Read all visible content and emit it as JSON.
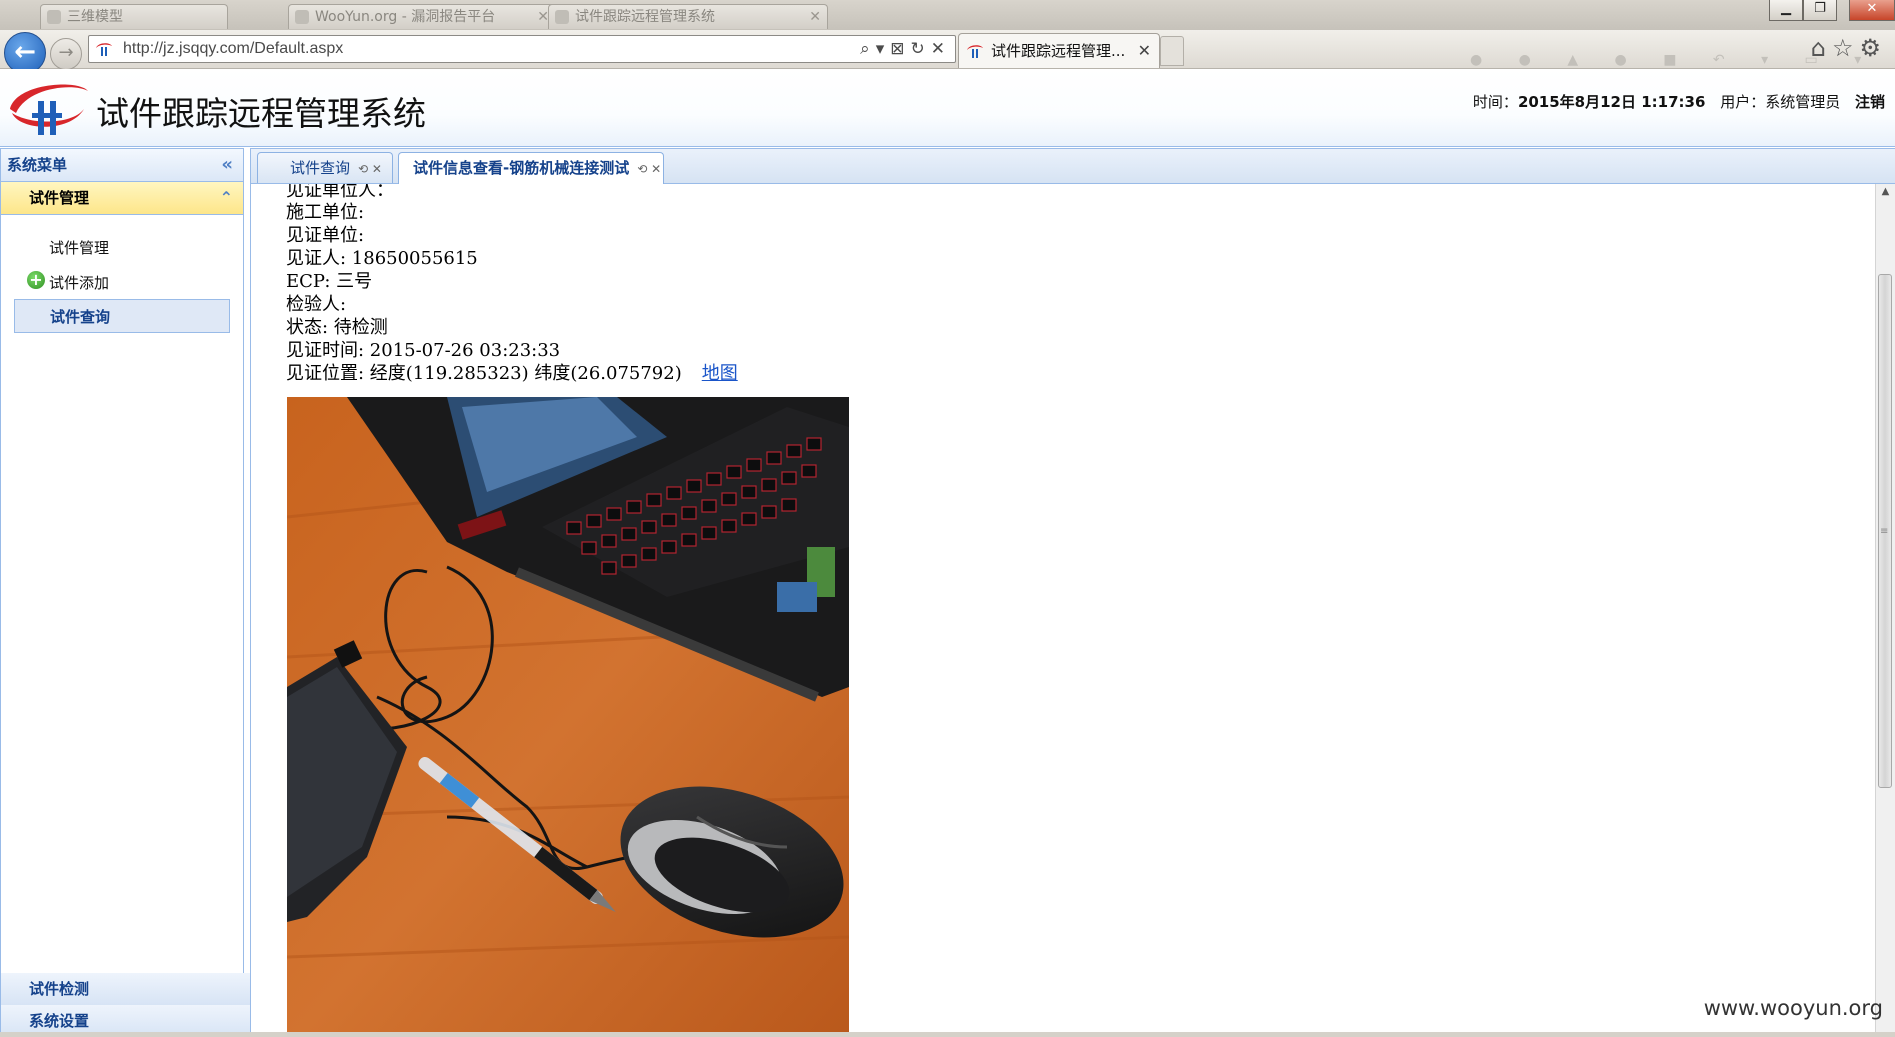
{
  "browser": {
    "url": "http://jz.jsqqy.com/Default.aspx",
    "active_tab_title": "试件跟踪远程管理...",
    "bg_tab_1": "三维模型",
    "bg_tab_2": "WooYun.org - 漏洞报告平台",
    "bg_tab_3": "试件跟踪远程管理系统"
  },
  "app": {
    "title": "试件跟踪远程管理系统",
    "time_label": "时间：",
    "time_value": "2015年8月12日 1:17:36",
    "user_label": "用户：系统管理员",
    "logout": "注销"
  },
  "sidebar": {
    "header": "系统菜单",
    "groups": [
      {
        "label": "试件管理",
        "items": [
          "试件管理",
          "试件添加",
          "试件查询"
        ],
        "selected": "试件查询"
      },
      {
        "label": "试件检测"
      },
      {
        "label": "系统设置"
      }
    ]
  },
  "tabs": [
    {
      "label": "试件查询",
      "active": false
    },
    {
      "label": "试件信息查看-钢筋机械连接测试",
      "active": true
    }
  ],
  "details": {
    "cut_off": "见证单位人：",
    "construction_unit": "施工单位:",
    "witness_unit": "见证单位:",
    "witness_person": "见证人: 18650055615",
    "ecp": "ECP: 三号",
    "inspector": "检验人:",
    "status": "状态: 待检测",
    "witness_time": "见证时间: 2015-07-26 03:23:33",
    "witness_location": "见证位置: 经度(119.285323) 纬度(26.075792)",
    "map_link": "地图"
  },
  "watermark": "www.wooyun.org",
  "colors": {
    "panel_border": "#99bbe8",
    "active_menu_bg": "#fde68a",
    "link": "#1a55c9",
    "title_blue": "#15428b"
  }
}
